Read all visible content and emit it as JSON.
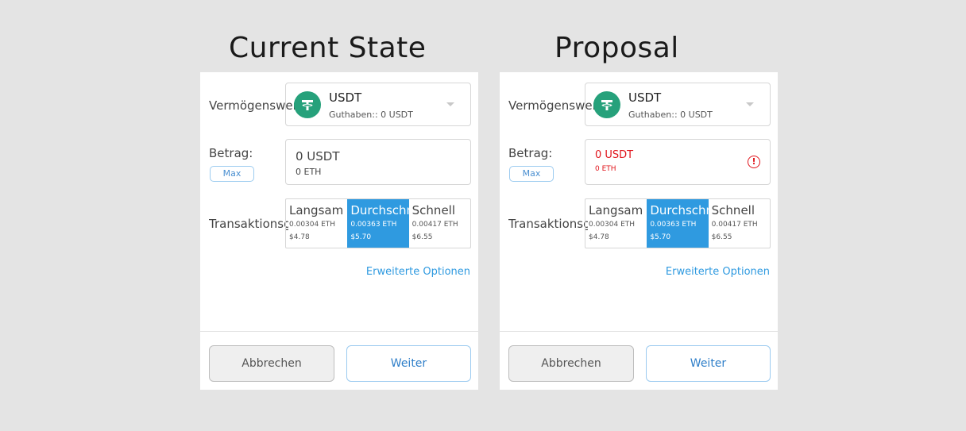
{
  "panels": [
    {
      "title": "Current State",
      "asset_label": "Vermögenswert",
      "asset": {
        "symbol": "USDT",
        "balance": "Guthaben:: 0 USDT",
        "icon": "tether-icon"
      },
      "amount_label": "Betrag:",
      "max_label": "Max",
      "amount": {
        "value": "0 USDT",
        "sub": "0 ETH",
        "state": "normal"
      },
      "tx_label": "Transaktionsgebühr",
      "fees": [
        {
          "name": "Langsam",
          "eth": "0.00304 ETH",
          "usd": "$4.78",
          "selected": false
        },
        {
          "name": "Durchschnitt",
          "eth": "0.00363 ETH",
          "usd": "$5.70",
          "selected": true
        },
        {
          "name": "Schnell",
          "eth": "0.00417 ETH",
          "usd": "$6.55",
          "selected": false
        }
      ],
      "advanced_link": "Erweiterte Optionen",
      "cancel_label": "Abbrechen",
      "next_label": "Weiter"
    },
    {
      "title": "Proposal",
      "asset_label": "Vermögenswert",
      "asset": {
        "symbol": "USDT",
        "balance": "Guthaben:: 0 USDT",
        "icon": "tether-icon"
      },
      "amount_label": "Betrag:",
      "max_label": "Max",
      "amount": {
        "value": "0 USDT",
        "sub": "0 ETH",
        "state": "error",
        "error_icon": "alert-circle-icon"
      },
      "tx_label": "Transaktionsgebühr",
      "fees": [
        {
          "name": "Langsam",
          "eth": "0.00304 ETH",
          "usd": "$4.78",
          "selected": false
        },
        {
          "name": "Durchschnitt",
          "eth": "0.00363 ETH",
          "usd": "$5.70",
          "selected": true
        },
        {
          "name": "Schnell",
          "eth": "0.00417 ETH",
          "usd": "$6.55",
          "selected": false
        }
      ],
      "advanced_link": "Erweiterte Optionen",
      "cancel_label": "Abbrechen",
      "next_label": "Weiter"
    }
  ],
  "colors": {
    "accent": "#2f9ae0",
    "error": "#e0141b",
    "tether": "#26a17b"
  }
}
